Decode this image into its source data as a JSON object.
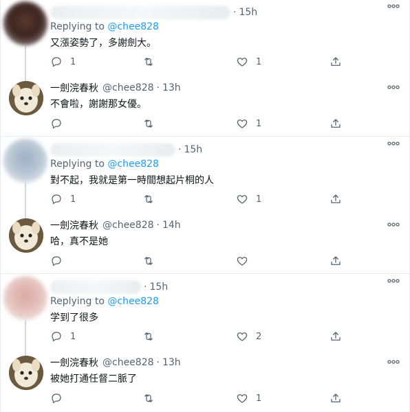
{
  "groups": [
    {
      "reply": {
        "time": "15h",
        "replying_prefix": "Replying to",
        "replying_handle": "@chee828",
        "text": "又漲姿勢了，多謝劍大。",
        "replies": "1",
        "retweets": "",
        "likes": "1"
      },
      "author": {
        "name": "一劍浣春秋",
        "handle": "@chee828",
        "time": "13h",
        "text": "不會啦，謝謝那女優。",
        "replies": "",
        "retweets": "",
        "likes": "1"
      }
    },
    {
      "reply": {
        "time": "15h",
        "replying_prefix": "Replying to",
        "replying_handle": "@chee828",
        "text": "對不起，我就是第一時間想起片桐的人",
        "replies": "1",
        "retweets": "",
        "likes": "1"
      },
      "author": {
        "name": "一劍浣春秋",
        "handle": "@chee828",
        "time": "14h",
        "text": "哈，真不是她",
        "replies": "",
        "retweets": "",
        "likes": ""
      }
    },
    {
      "reply": {
        "time": "15h",
        "replying_prefix": "Replying to",
        "replying_handle": "@chee828",
        "text": "学到了很多",
        "replies": "1",
        "retweets": "",
        "likes": "2"
      },
      "author": {
        "name": "一劍浣春秋",
        "handle": "@chee828",
        "time": "13h",
        "text": "被她打通任督二脈了",
        "replies": "",
        "retweets": "",
        "likes": "1"
      }
    }
  ],
  "colors": {
    "link": "#1d9bf0",
    "muted": "#536471",
    "text": "#0f1419",
    "divider": "#e6ecf0"
  },
  "icons": [
    "reply-icon",
    "retweet-icon",
    "like-icon",
    "share-icon",
    "more-options-icon"
  ]
}
